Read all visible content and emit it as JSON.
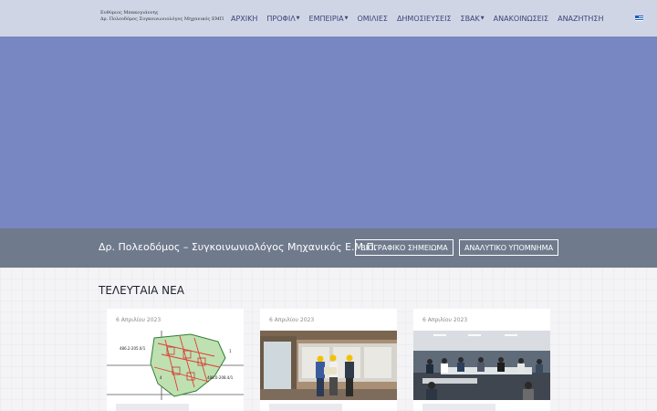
{
  "header": {
    "logo_line1": "Ευθύμιος Μπακογιάννης",
    "logo_line2": "Δρ. Πολεοδόμος Συγκοινωνιολόγος Μηχανικός ΕΜΠ",
    "nav": [
      {
        "label": "ΑΡΧΙΚΗ",
        "dropdown": false
      },
      {
        "label": "ΠΡΟΦΙΛ",
        "dropdown": true
      },
      {
        "label": "ΕΜΠΕΙΡΙΑ",
        "dropdown": true
      },
      {
        "label": "ΟΜΙΛΙΕΣ",
        "dropdown": false
      },
      {
        "label": "ΔΗΜΟΣΙΕΥΣΕΙΣ",
        "dropdown": false
      },
      {
        "label": "ΣΒΑΚ",
        "dropdown": true
      },
      {
        "label": "ΑΝΑΚΟΙΝΩΣΕΙΣ",
        "dropdown": false
      },
      {
        "label": "ΑΝΑΖΗΤΗΣΗ",
        "dropdown": false
      }
    ],
    "language_icon": "greek-flag-icon"
  },
  "banner": {
    "title": "Δρ. Πολεοδόμος – Συγκοινωνιολόγος Μηχανικός Ε.Μ.Π.",
    "cv_button": "ΒΙΟΓΡΑΦΙΚΟ ΣΗΜΕΙΩΜΑ",
    "memo_button": "ΑΝΑΛΥΤΙΚΟ ΥΠΟΜΝΗΜΑ"
  },
  "news": {
    "heading": "ΤΕΛΕΥΤΑΙΑ ΝΕΑ",
    "cards": [
      {
        "date": "6 Απριλίου 2023",
        "image": "cadastral-map-image"
      },
      {
        "date": "6 Απριλίου 2023",
        "image": "construction-workers-image"
      },
      {
        "date": "6 Απριλίου 2023",
        "image": "meeting-room-image"
      }
    ]
  },
  "colors": {
    "header_bg": "#d0d5e6",
    "nav_text": "#3a4576",
    "hero_bg": "#7887c1",
    "banner_bg": "#707a8d"
  }
}
